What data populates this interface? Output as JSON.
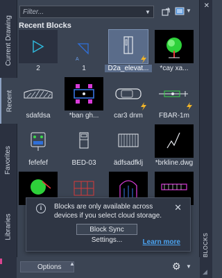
{
  "palette": {
    "title": "BLOCKS",
    "close_glyph": "✕"
  },
  "side_tabs": {
    "current": "Current Drawing",
    "recent": "Recent",
    "favorites": "Favorites",
    "libraries": "Libraries"
  },
  "filter": {
    "placeholder": "Filter...",
    "value": ""
  },
  "toolbar": {
    "icons": [
      "block-sync-icon",
      "view-mode-icon"
    ]
  },
  "section": {
    "title": "Recent Blocks"
  },
  "blocks": [
    {
      "label": "2",
      "icon": "triangle-block-icon",
      "selected": false
    },
    {
      "label": "1",
      "icon": "attribute-line-block-icon",
      "selected": false
    },
    {
      "label": "D2a_elevat...",
      "icon": "door-elevation-block-icon",
      "selected": true,
      "synced": true
    },
    {
      "label": "*cay xa...",
      "icon": "tree-block-icon",
      "selected": false
    },
    {
      "label": "sdafdsa",
      "icon": "hatched-slab-block-icon",
      "selected": false
    },
    {
      "label": "*ban gh...",
      "icon": "table-chairs-block-icon",
      "selected": false
    },
    {
      "label": "car3 dnm",
      "icon": "car-block-icon",
      "selected": false,
      "synced": true
    },
    {
      "label": "FBAR-1m",
      "icon": "scale-bar-block-icon",
      "selected": false,
      "synced": true
    },
    {
      "label": "fefefef",
      "icon": "device-block-icon",
      "selected": false
    },
    {
      "label": "BED-03",
      "icon": "bed-block-icon",
      "selected": false
    },
    {
      "label": "ädfsadfklj",
      "icon": "stair-block-icon",
      "selected": false
    },
    {
      "label": "*brkline.dwg",
      "icon": "break-line-block-icon",
      "selected": false
    },
    {
      "label": "",
      "icon": "tree-block-icon",
      "selected": false
    },
    {
      "label": "",
      "icon": "red-grid-block-icon",
      "selected": false
    },
    {
      "label": "",
      "icon": "arch-block-icon",
      "selected": false
    },
    {
      "label": "",
      "icon": "bench-block-icon",
      "selected": false
    }
  ],
  "notification": {
    "message": "Blocks are only available across devices if you select cloud storage.",
    "button": "Block Sync Settings...",
    "link": "Learn more",
    "close_glyph": "✕"
  },
  "bottom": {
    "options_label": "Options"
  },
  "colors": {
    "panel": "#3b4453",
    "strip": "#2b3140",
    "link": "#4ba3f0",
    "selected": "#5a6c8a",
    "bolt": "#f0b429"
  }
}
